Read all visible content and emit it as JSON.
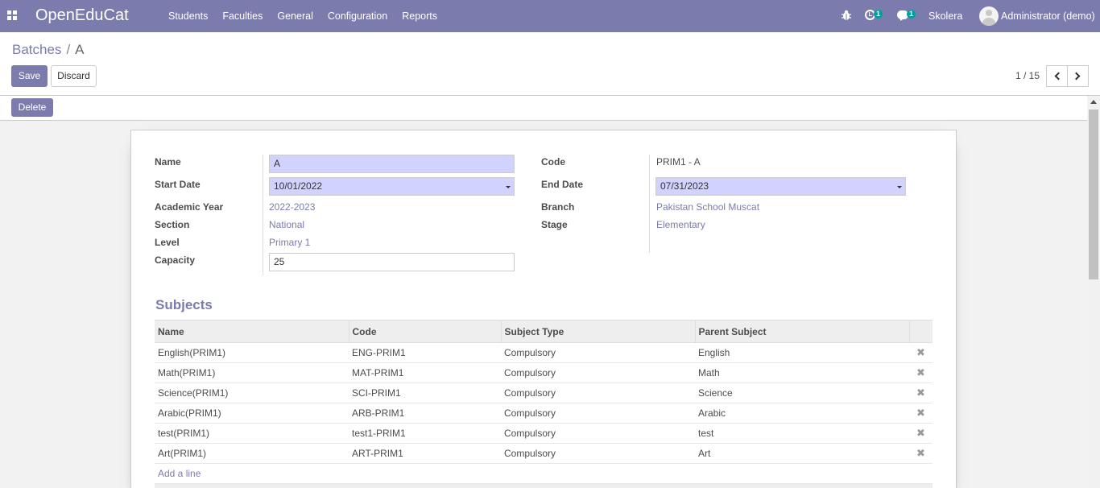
{
  "navbar": {
    "brand": "OpenEduCat",
    "menu": [
      "Students",
      "Faculties",
      "General",
      "Configuration",
      "Reports"
    ],
    "activity_count": "1",
    "message_count": "1",
    "company": "Skolera",
    "user": "Administrator (demo)",
    "icons": [
      "apps-icon",
      "bug-icon",
      "activity-icon",
      "chat-icon"
    ],
    "color": "#7c7bad"
  },
  "breadcrumb": {
    "parent": "Batches",
    "current": "A"
  },
  "buttons": {
    "save": "Save",
    "discard": "Discard",
    "delete": "Delete"
  },
  "pager": {
    "value": "1 / 15"
  },
  "form": {
    "name_label": "Name",
    "name_value": "A",
    "start_date_label": "Start Date",
    "start_date_value": "10/01/2022",
    "academic_year_label": "Academic Year",
    "academic_year_value": "2022-2023",
    "section_label": "Section",
    "section_value": "National",
    "level_label": "Level",
    "level_value": "Primary 1",
    "capacity_label": "Capacity",
    "capacity_value": "25",
    "code_label": "Code",
    "code_value": "PRIM1 - A",
    "end_date_label": "End Date",
    "end_date_value": "07/31/2023",
    "branch_label": "Branch",
    "branch_value": "Pakistan School Muscat",
    "stage_label": "Stage",
    "stage_value": "Elementary"
  },
  "subjects": {
    "title": "Subjects",
    "columns": [
      "Name",
      "Code",
      "Subject Type",
      "Parent Subject"
    ],
    "rows": [
      [
        "English(PRIM1)",
        "ENG-PRIM1",
        "Compulsory",
        "English"
      ],
      [
        "Math(PRIM1)",
        "MAT-PRIM1",
        "Compulsory",
        "Math"
      ],
      [
        "Science(PRIM1)",
        "SCI-PRIM1",
        "Compulsory",
        "Science"
      ],
      [
        "Arabic(PRIM1)",
        "ARB-PRIM1",
        "Compulsory",
        "Arabic"
      ],
      [
        "test(PRIM1)",
        "test1-PRIM1",
        "Compulsory",
        "test"
      ],
      [
        "Art(PRIM1)",
        "ART-PRIM1",
        "Compulsory",
        "Art"
      ]
    ],
    "add_line": "Add a line"
  }
}
